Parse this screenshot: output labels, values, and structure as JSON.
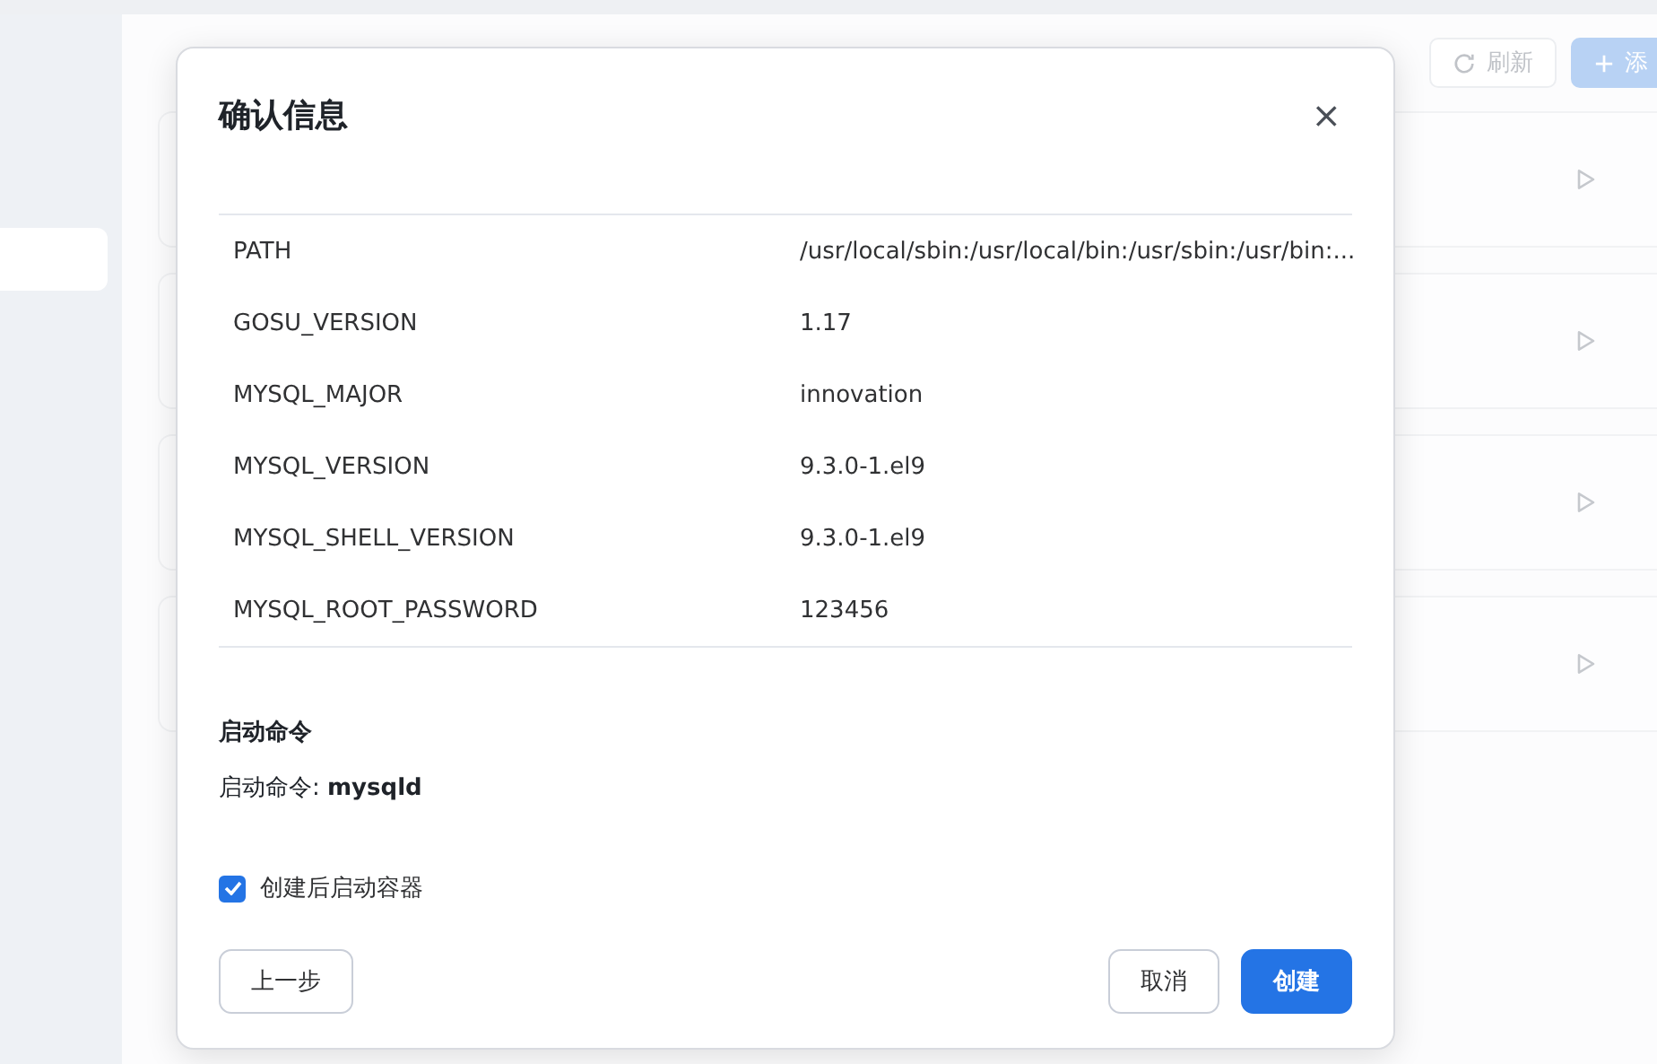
{
  "page": {
    "buttons": [
      {
        "label": "刷新",
        "kind": "refresh"
      },
      {
        "label": "添",
        "kind": "add"
      }
    ],
    "cards": [
      {
        "kind": "play"
      },
      {
        "kind": "play"
      },
      {
        "kind": "play"
      },
      {
        "kind": "play"
      }
    ]
  },
  "dialog": {
    "title": "确认信息",
    "close": "×",
    "env_rows": [
      {
        "name": "PATH",
        "value": "/usr/local/sbin:/usr/local/bin:/usr/sbin:/usr/bin:..."
      },
      {
        "name": "GOSU_VERSION",
        "value": "1.17"
      },
      {
        "name": "MYSQL_MAJOR",
        "value": "innovation"
      },
      {
        "name": "MYSQL_VERSION",
        "value": "9.3.0-1.el9"
      },
      {
        "name": "MYSQL_SHELL_VERSION",
        "value": "9.3.0-1.el9"
      },
      {
        "name": "MYSQL_ROOT_PASSWORD",
        "value": "123456"
      }
    ],
    "command_heading": "启动命令",
    "command_text": "启动命令: **mysqld**",
    "start_after_create": {
      "label": "创建后启动容器",
      "checked": true
    },
    "buttons": [
      {
        "label": "上一步",
        "kind": "secondary"
      },
      {
        "label": "取消",
        "kind": "secondary"
      },
      {
        "label": "创建",
        "kind": "primary"
      }
    ]
  }
}
